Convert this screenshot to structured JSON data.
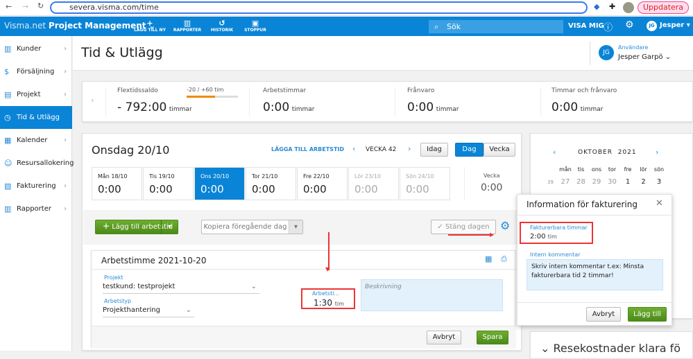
{
  "browser": {
    "url": "severa.visma.com/time",
    "update": "Uppdatera"
  },
  "appbar": {
    "brand_light": "Visma.net",
    "brand_bold": "Project Management",
    "tools": [
      {
        "label": "LÄGG TILL NY",
        "icon": "+"
      },
      {
        "label": "RAPPORTER",
        "icon": "▥"
      },
      {
        "label": "HISTORIK",
        "icon": "↺"
      },
      {
        "label": "STOPPUR",
        "icon": "▣"
      }
    ],
    "search_placeholder": "Sök",
    "show_me": "VISA MIG",
    "user_initials": "JG",
    "user": "Jesper"
  },
  "sidebar": {
    "items": [
      {
        "label": "Kunder",
        "icon": "▥"
      },
      {
        "label": "Försäljning",
        "icon": "$"
      },
      {
        "label": "Projekt",
        "icon": "▤"
      },
      {
        "label": "Tid & Utlägg",
        "icon": "◷"
      },
      {
        "label": "Kalender",
        "icon": "▦"
      },
      {
        "label": "Resursallokering",
        "icon": "☺"
      },
      {
        "label": "Fakturering",
        "icon": "▧"
      },
      {
        "label": "Rapporter",
        "icon": "▥"
      }
    ]
  },
  "header": {
    "title": "Tid & Utlägg",
    "user_label": "Användare",
    "user_name": "Jesper Garpö",
    "initials": "JG"
  },
  "summary": {
    "flex_label": "Flextidssaldo",
    "flex_range": "-20 / +60 tim",
    "flex_progress": 0.55,
    "flex_value": "- 792:00",
    "unit": "timmar",
    "work_label": "Arbetstimmar",
    "work_value": "0:00",
    "absence_label": "Frånvaro",
    "absence_value": "0:00",
    "total_label": "Timmar och frånvaro",
    "total_value": "0:00"
  },
  "day": {
    "title": "Onsdag 20/10",
    "add_link": "LÄGGA TILL ARBETSTID",
    "week": "VECKA 42",
    "today": "Idag",
    "day_tab": "Dag",
    "week_tab": "Vecka",
    "days": [
      {
        "label": "Mån 18/10",
        "value": "0:00"
      },
      {
        "label": "Tis 19/10",
        "value": "0:00"
      },
      {
        "label": "Ons 20/10",
        "value": "0:00"
      },
      {
        "label": "Tor 21/10",
        "value": "0:00"
      },
      {
        "label": "Fre 22/10",
        "value": "0:00"
      },
      {
        "label": "Lör 23/10",
        "value": "0:00"
      },
      {
        "label": "Sön 24/10",
        "value": "0:00"
      }
    ],
    "week_label": "Vecka",
    "week_value": "0:00",
    "add_btn": "Lägg till arbetstid",
    "copy_btn": "Kopiera föregående dag",
    "close_day": "Stäng dagen"
  },
  "entry": {
    "title": "Arbetstimme 2021-10-20",
    "project_label": "Projekt",
    "project": "testkund: testprojekt",
    "type_label": "Arbetstyp",
    "type": "Projekthantering",
    "hours_label": "Arbetsti...",
    "hours": "1:30",
    "hours_unit": "tim",
    "desc_placeholder": "Beskrivning",
    "cancel": "Avbryt",
    "save": "Spara"
  },
  "calendar": {
    "month": "OKTOBER",
    "year": "2021",
    "weekdays": [
      "mån",
      "tis",
      "ons",
      "tor",
      "fre",
      "lör",
      "sön"
    ],
    "week_no": "39",
    "days": [
      "27",
      "28",
      "29",
      "30",
      "1",
      "2",
      "3"
    ]
  },
  "popup": {
    "title": "Information för fakturering",
    "billable_label": "Fakturerbara timmar",
    "billable": "2:00",
    "unit": "tim",
    "comment_label": "Intern kommentar",
    "comment": "Skriv intern kommentar t.ex: Minsta fakturerbara tid 2 timmar!",
    "cancel": "Avbryt",
    "add": "Lägg till"
  },
  "bottom_card": "Resekostnader klara fö"
}
